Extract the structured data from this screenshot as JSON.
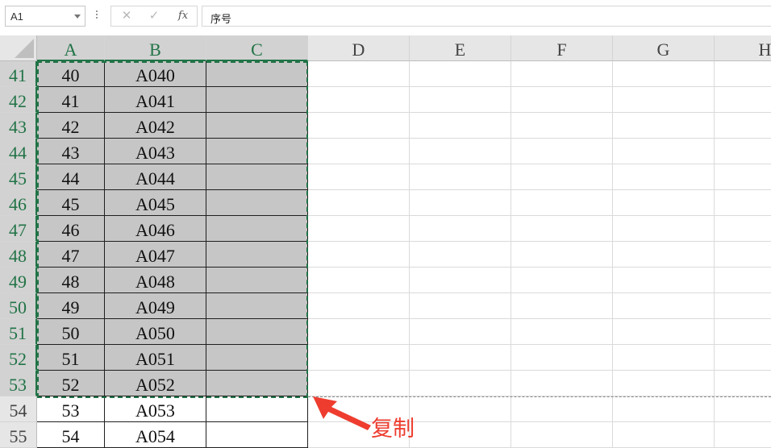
{
  "formula_bar": {
    "name_box": "A1",
    "cancel_glyph": "✕",
    "enter_glyph": "✓",
    "fx_label": "fx",
    "formula": "序号"
  },
  "columns": [
    "A",
    "B",
    "C",
    "D",
    "E",
    "F",
    "G",
    "H"
  ],
  "selected_columns": [
    "A",
    "B",
    "C"
  ],
  "rows": [
    {
      "num": "41",
      "a": "40",
      "b": "A040",
      "c": ""
    },
    {
      "num": "42",
      "a": "41",
      "b": "A041",
      "c": ""
    },
    {
      "num": "43",
      "a": "42",
      "b": "A042",
      "c": ""
    },
    {
      "num": "44",
      "a": "43",
      "b": "A043",
      "c": ""
    },
    {
      "num": "45",
      "a": "44",
      "b": "A044",
      "c": ""
    },
    {
      "num": "46",
      "a": "45",
      "b": "A045",
      "c": ""
    },
    {
      "num": "47",
      "a": "46",
      "b": "A046",
      "c": ""
    },
    {
      "num": "48",
      "a": "47",
      "b": "A047",
      "c": ""
    },
    {
      "num": "49",
      "a": "48",
      "b": "A048",
      "c": ""
    },
    {
      "num": "50",
      "a": "49",
      "b": "A049",
      "c": ""
    },
    {
      "num": "51",
      "a": "50",
      "b": "A050",
      "c": ""
    },
    {
      "num": "52",
      "a": "51",
      "b": "A051",
      "c": ""
    },
    {
      "num": "53",
      "a": "52",
      "b": "A052",
      "c": ""
    },
    {
      "num": "54",
      "a": "53",
      "b": "A053",
      "c": ""
    },
    {
      "num": "55",
      "a": "54",
      "b": "A054",
      "c": ""
    }
  ],
  "selected_row_count": 13,
  "annotation": {
    "label": "复制",
    "color": "#ee3d2f"
  },
  "colors": {
    "selection_accent": "#217346",
    "selection_fill": "#c6c6c6",
    "header_fill": "#e6e6e6"
  }
}
